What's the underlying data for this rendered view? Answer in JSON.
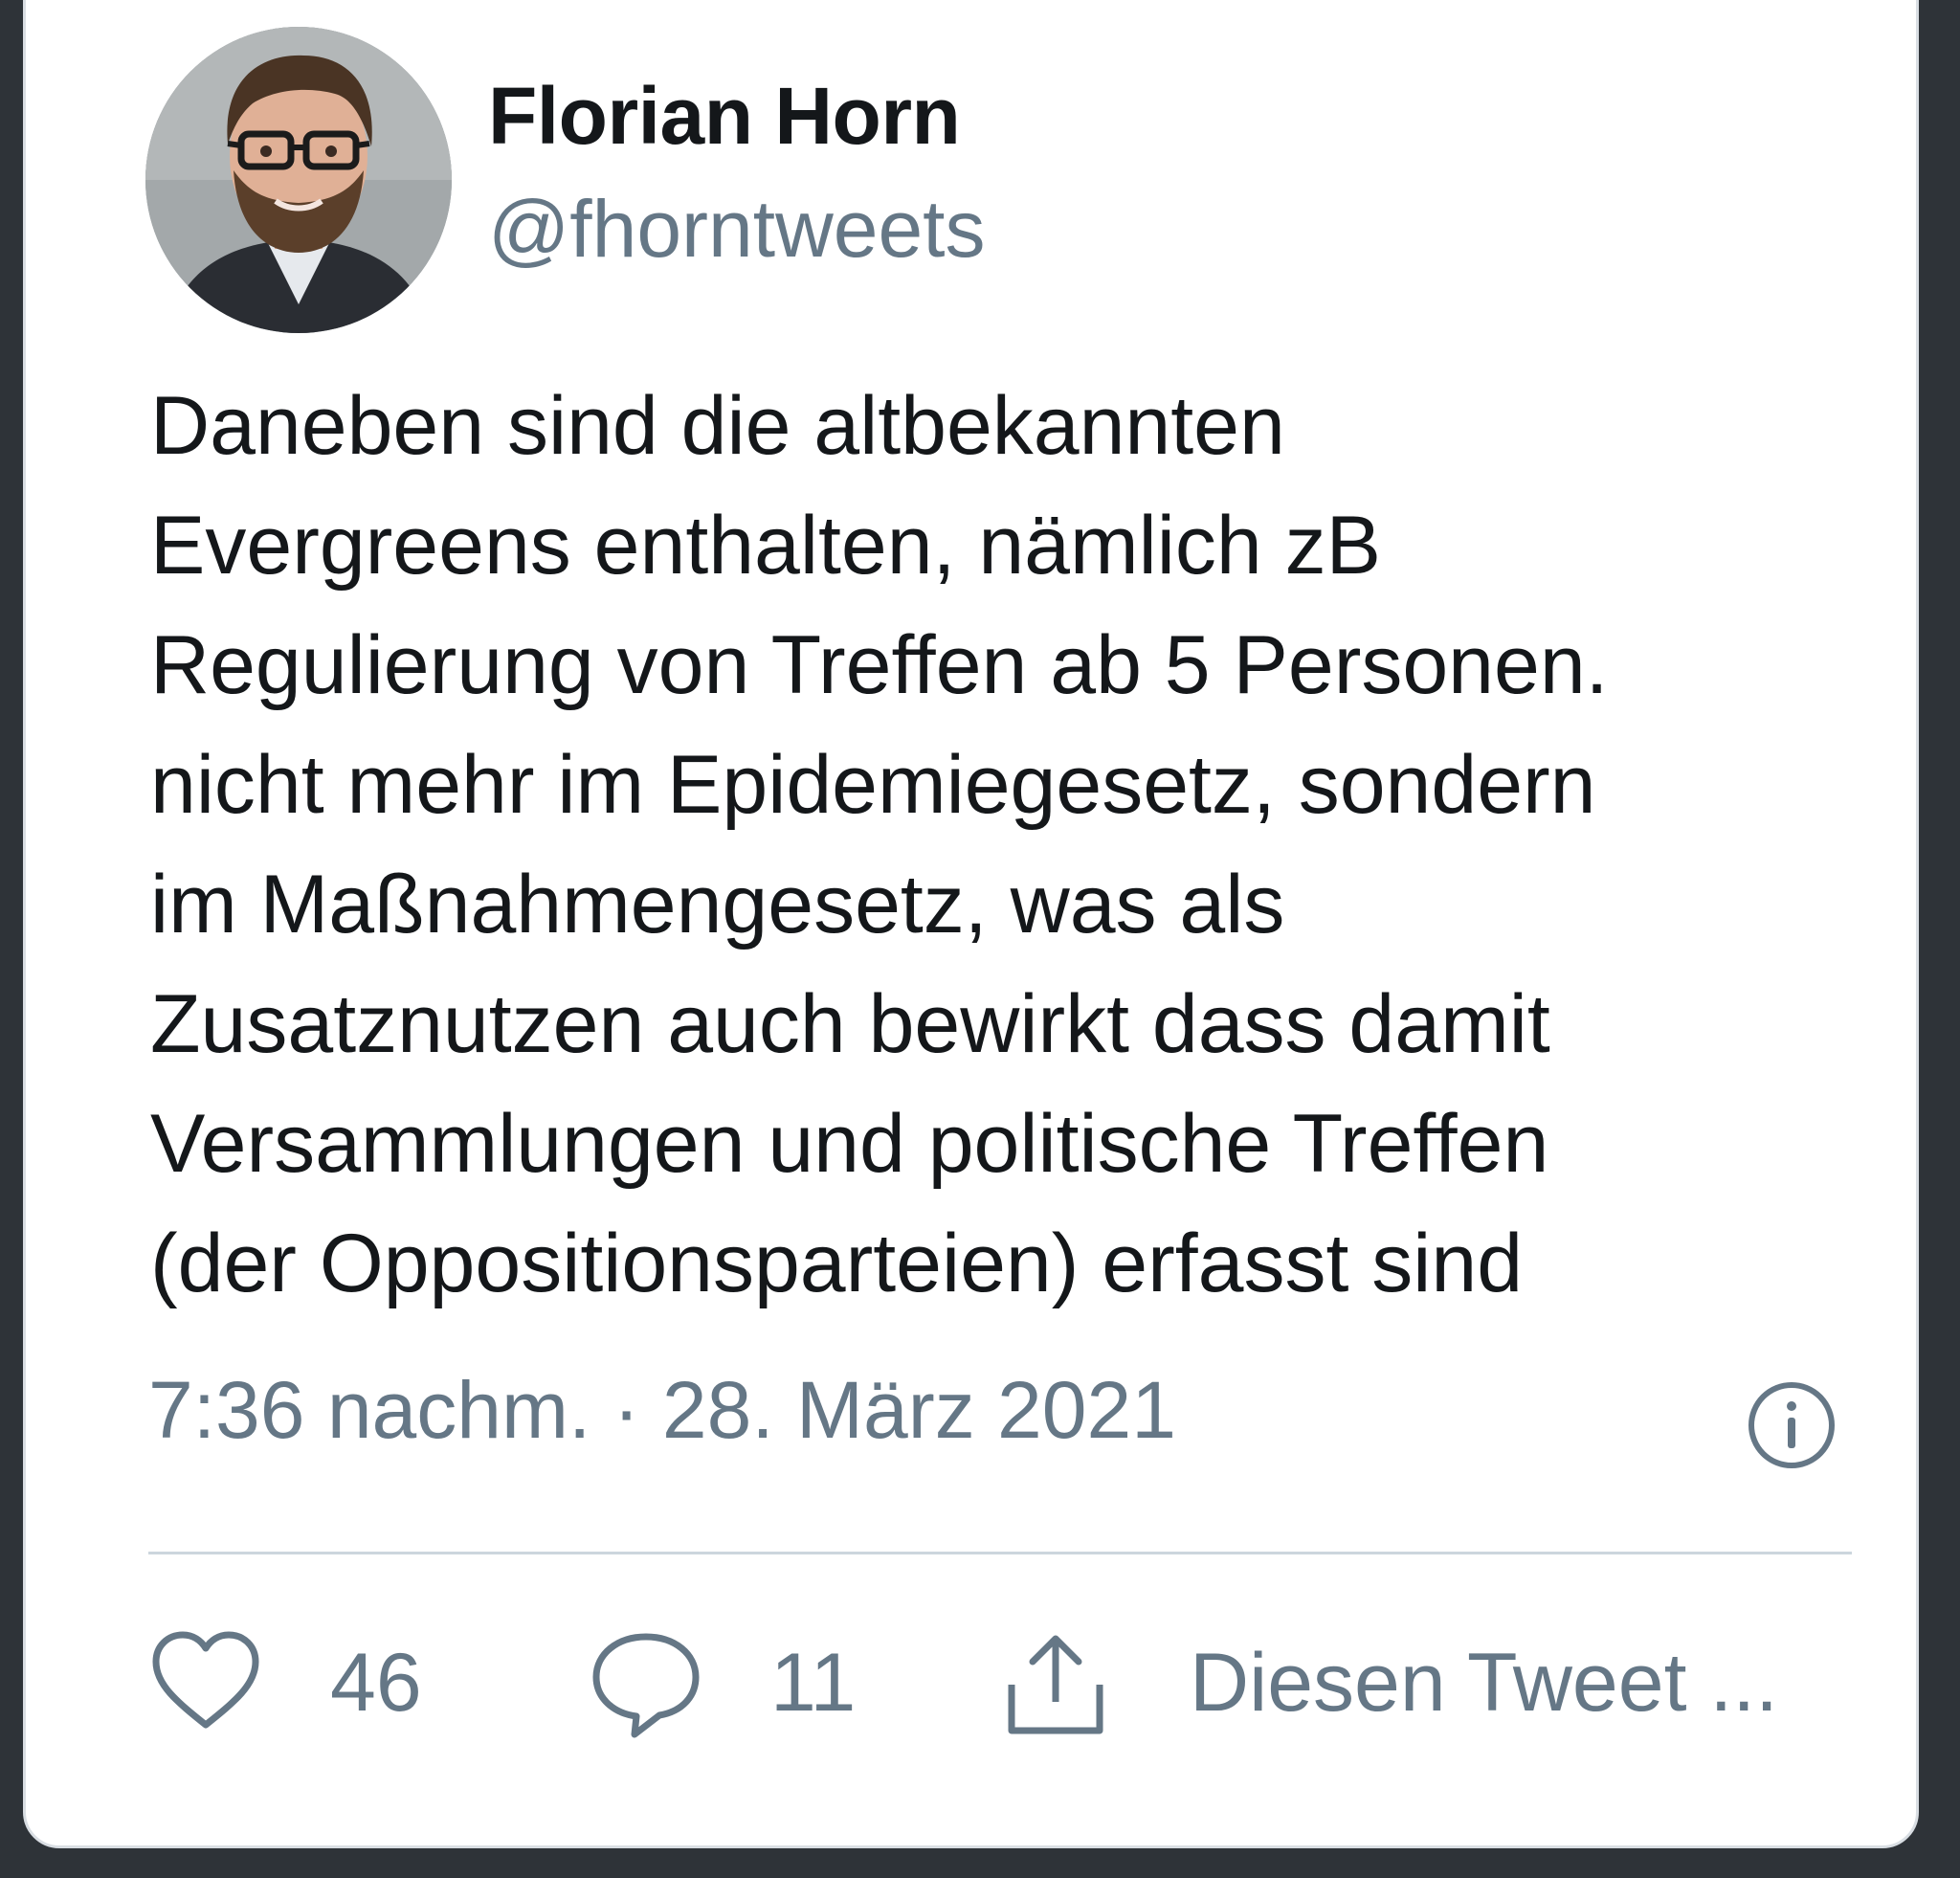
{
  "tweet": {
    "author_name": "Florian Horn",
    "author_handle": "@fhorntweets",
    "text_lines": [
      "Daneben sind die altbekannten",
      "Evergreens enthalten, nämlich zB",
      "Regulierung von Treffen ab 5 Personen.",
      "nicht mehr im Epidemiegesetz, sondern",
      "im Maßnahmengesetz, was als",
      "Zusatznutzen auch bewirkt dass damit",
      "Versammlungen und politische Treffen",
      "(der Oppositionsparteien) erfasst sind"
    ],
    "timestamp": "7:36 nachm. · 28. März 2021"
  },
  "actions": {
    "like_count": "46",
    "reply_count": "11",
    "share_label": "Diesen Tweet ..."
  },
  "icons": {
    "avatar": "profile-photo",
    "info": "info-icon",
    "like": "heart-icon",
    "reply": "speech-bubble-icon",
    "share": "share-upload-icon"
  },
  "colors": {
    "background": "#2e3338",
    "card": "#ffffff",
    "text_primary": "#14171a",
    "text_secondary": "#657786",
    "divider": "#ccd6dd"
  }
}
